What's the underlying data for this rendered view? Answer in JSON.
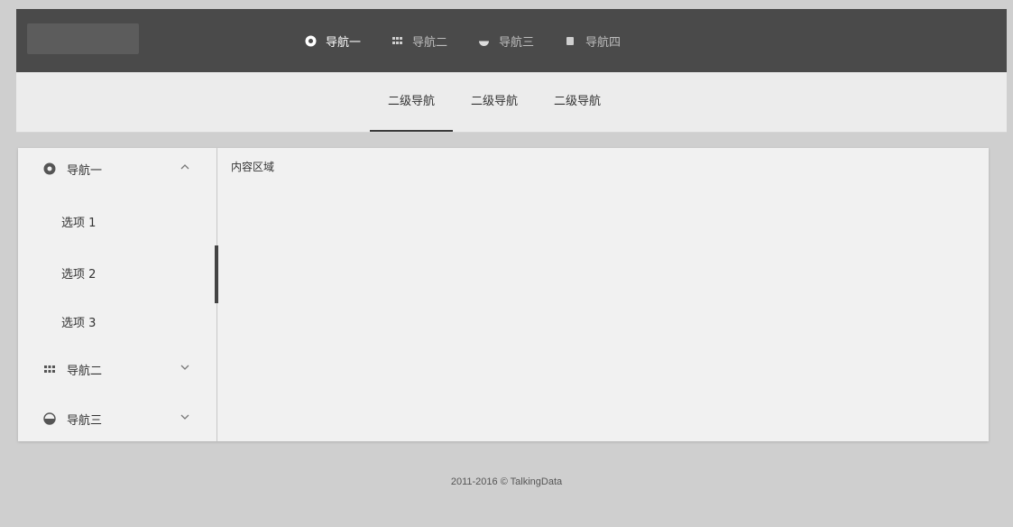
{
  "top_nav": {
    "items": [
      {
        "label": "导航一",
        "icon": "circle-dot-icon"
      },
      {
        "label": "导航二",
        "icon": "grid-icon"
      },
      {
        "label": "导航三",
        "icon": "half-circle-icon"
      },
      {
        "label": "导航四",
        "icon": "square-icon"
      }
    ]
  },
  "sub_nav": {
    "items": [
      "二级导航",
      "二级导航",
      "二级导航"
    ]
  },
  "sidebar": {
    "groups": [
      {
        "label": "导航一",
        "icon": "circle-dot-icon",
        "expanded": true,
        "items": [
          "选项 1",
          "选项 2",
          "选项 3"
        ]
      },
      {
        "label": "导航二",
        "icon": "grid-icon",
        "expanded": false
      },
      {
        "label": "导航三",
        "icon": "half-circle-icon",
        "expanded": false
      }
    ]
  },
  "content": {
    "title": "内容区域"
  },
  "footer": {
    "text": "2011-2016 © TalkingData"
  },
  "colors": {
    "topbar": "#4a4a4a",
    "subbar": "#ececec",
    "panel": "#f1f1f1"
  }
}
